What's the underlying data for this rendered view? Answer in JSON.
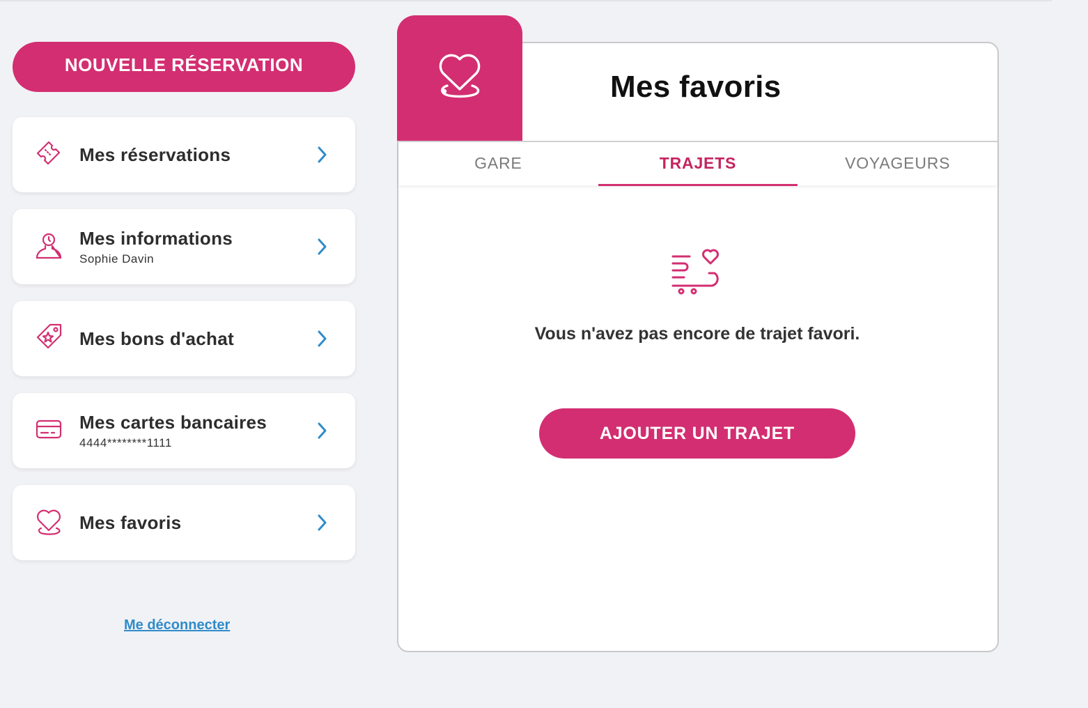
{
  "colors": {
    "accent": "#d32e71",
    "link": "#2f8bc9",
    "chevron": "#2f8bc9",
    "background": "#f1f2f6"
  },
  "sidebar": {
    "new_booking_label": "NOUVELLE RÉSERVATION",
    "items": [
      {
        "title": "Mes réservations",
        "subtitle": "",
        "icon": "ticket-icon"
      },
      {
        "title": "Mes informations",
        "subtitle": "Sophie Davin",
        "icon": "user-icon"
      },
      {
        "title": "Mes bons d'achat",
        "subtitle": "",
        "icon": "voucher-tag-icon"
      },
      {
        "title": "Mes cartes bancaires",
        "subtitle": "4444********1111",
        "icon": "credit-card-icon"
      },
      {
        "title": "Mes favoris",
        "subtitle": "",
        "icon": "heart-icon"
      }
    ],
    "logout_label": "Me déconnecter"
  },
  "main": {
    "title": "Mes favoris",
    "header_icon": "heart-icon",
    "tabs": [
      {
        "label": "GARE",
        "active": false
      },
      {
        "label": "TRAJETS",
        "active": true
      },
      {
        "label": "VOYAGEURS",
        "active": false
      }
    ],
    "empty_state": {
      "icon": "train-heart-icon",
      "message": "Vous n'avez pas encore de trajet favori.",
      "button_label": "AJOUTER UN TRAJET"
    }
  }
}
